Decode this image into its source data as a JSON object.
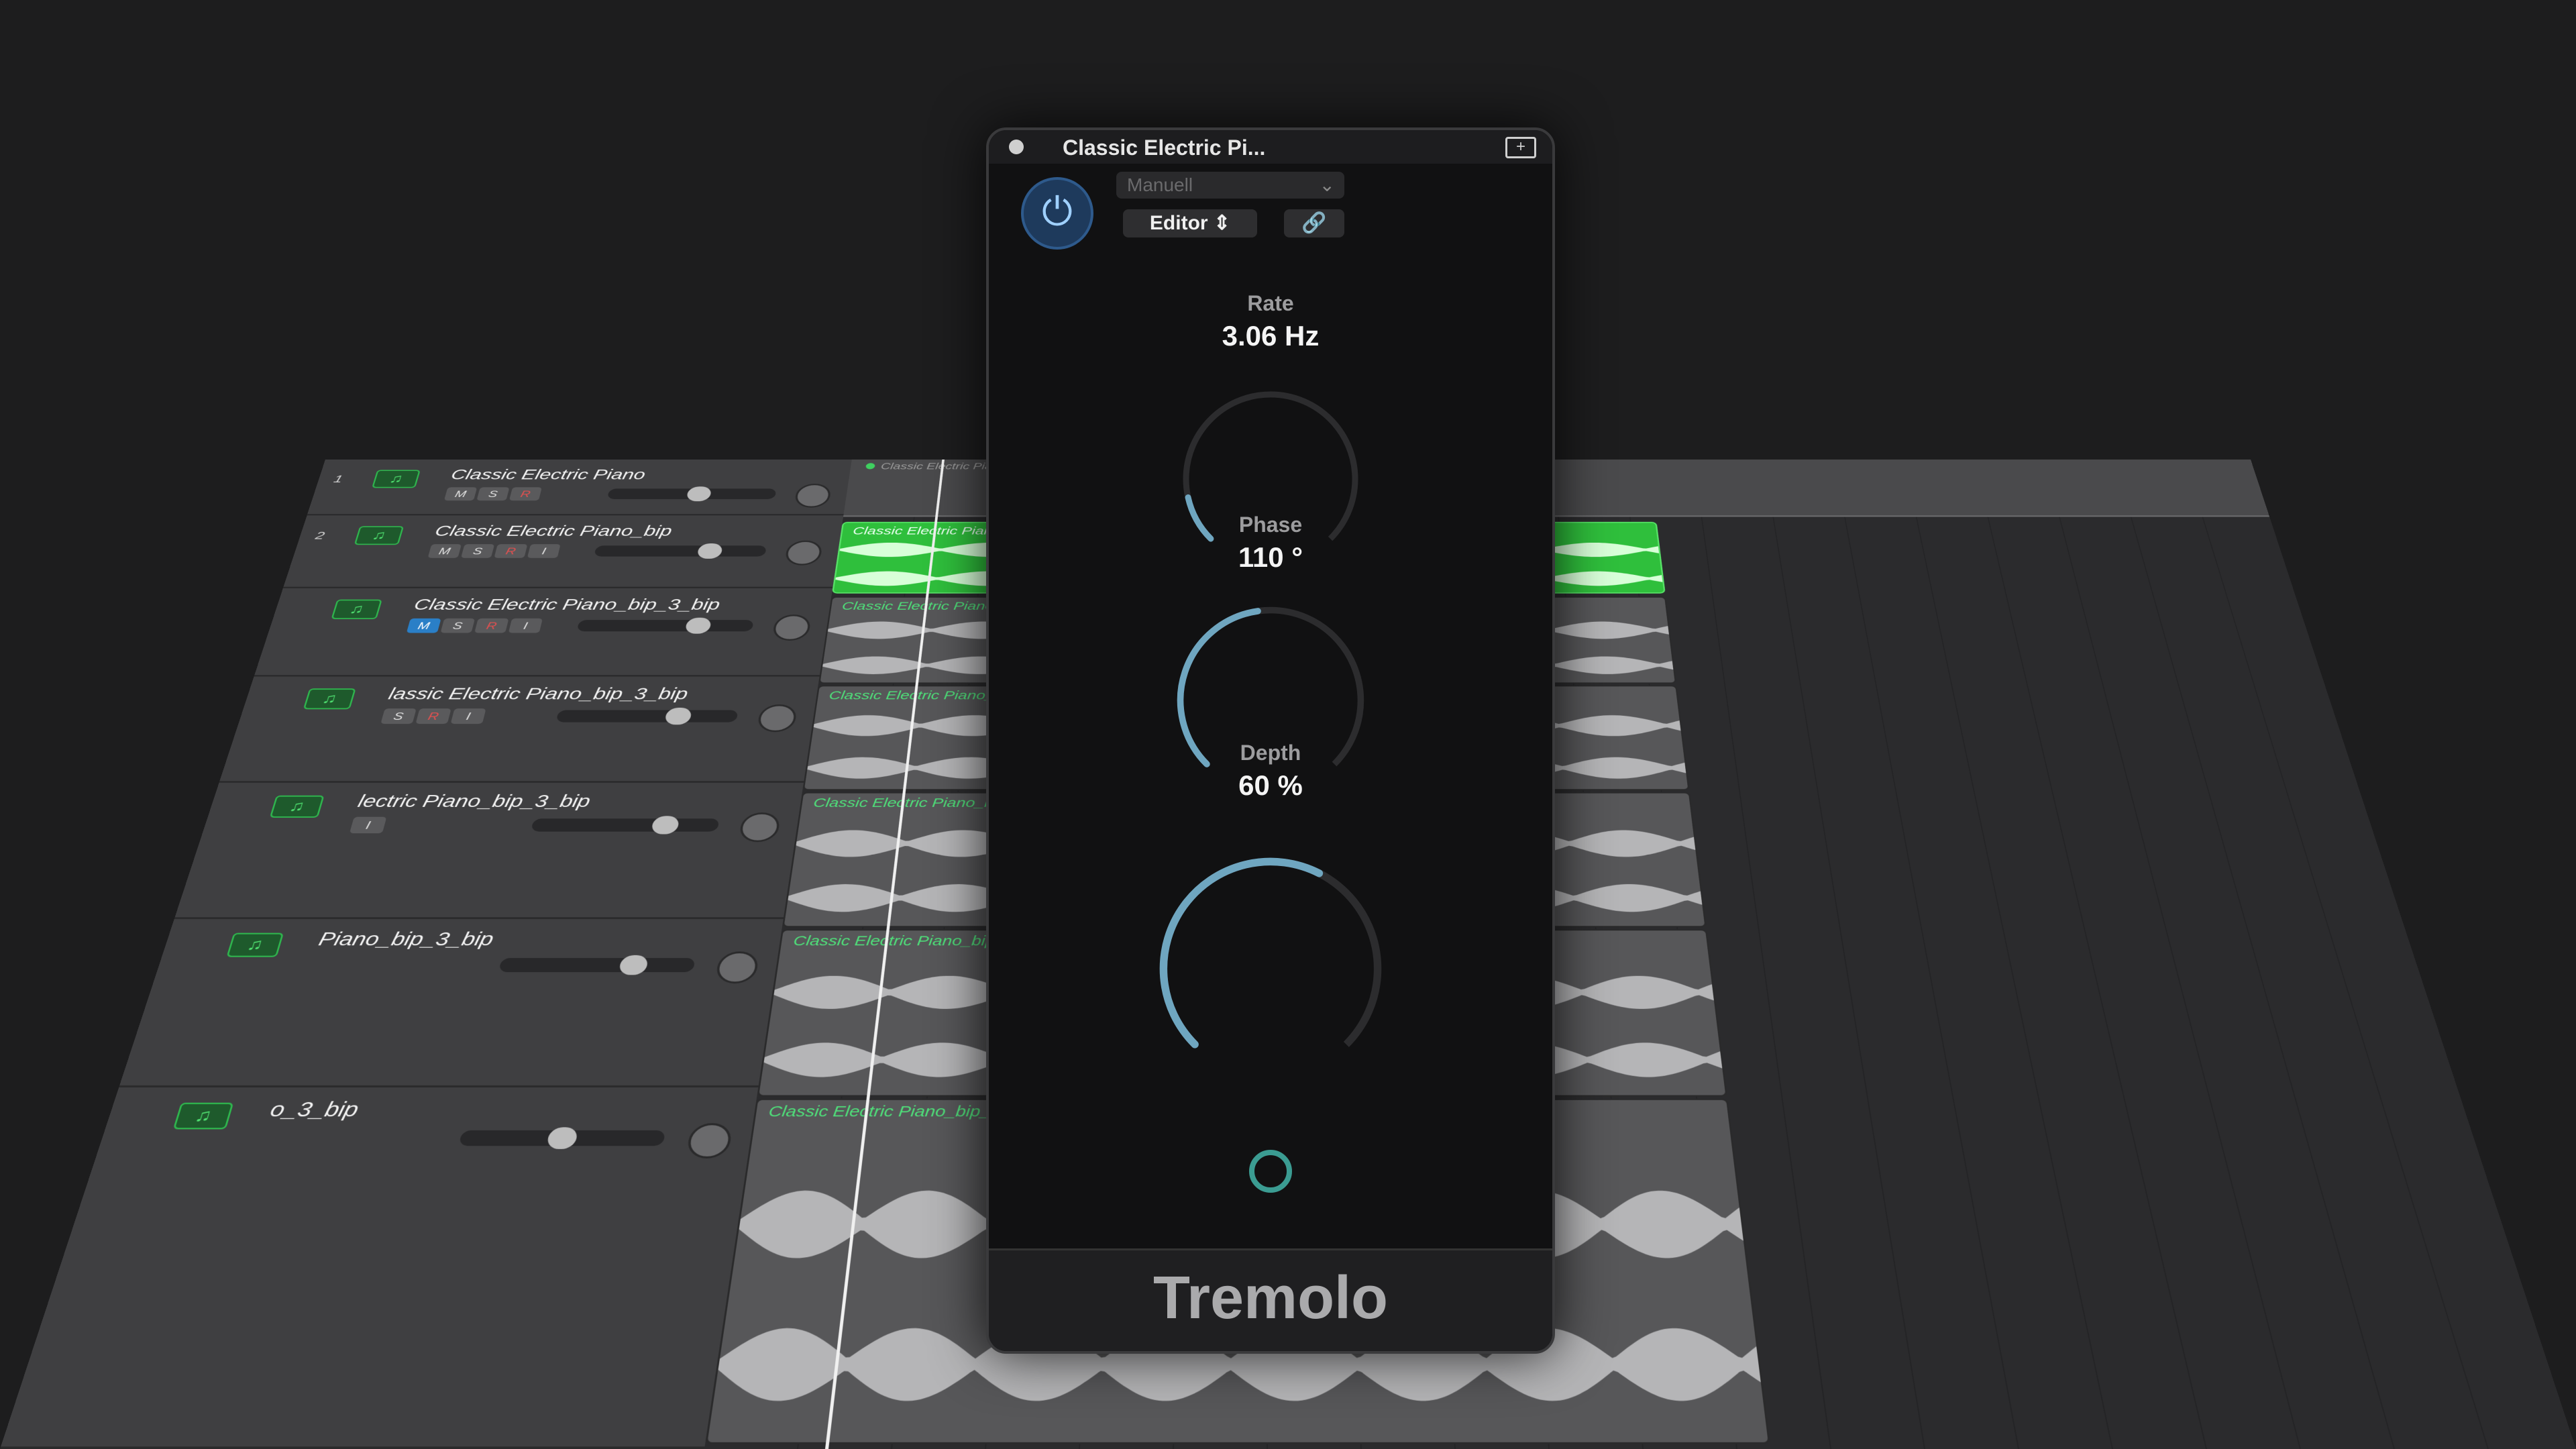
{
  "top_region": {
    "label": "Classic Electric Piano"
  },
  "tracks": [
    {
      "number": "1",
      "name": "Classic Electric Piano",
      "mute": "M",
      "solo": "S",
      "rec": "R",
      "input": "",
      "muted": false,
      "fader": 0.55
    },
    {
      "number": "2",
      "name": "Classic Electric Piano_bip",
      "mute": "M",
      "solo": "S",
      "rec": "R",
      "input": "I",
      "muted": false,
      "fader": 0.7
    },
    {
      "number": "",
      "name": "Classic Electric Piano_bip_3_bip",
      "mute": "M",
      "solo": "S",
      "rec": "R",
      "input": "I",
      "muted": true,
      "fader": 0.72
    },
    {
      "number": "",
      "name": "lassic Electric Piano_bip_3_bip",
      "mute": "",
      "solo": "S",
      "rec": "R",
      "input": "I",
      "muted": true,
      "fader": 0.7
    },
    {
      "number": "",
      "name": "lectric Piano_bip_3_bip",
      "mute": "",
      "solo": "",
      "rec": "",
      "input": "I",
      "muted": false,
      "fader": 0.75
    },
    {
      "number": "",
      "name": "Piano_bip_3_bip",
      "mute": "",
      "solo": "",
      "rec": "",
      "input": "",
      "muted": false,
      "fader": 0.72
    },
    {
      "number": "",
      "name": "o_3_bip",
      "mute": "",
      "solo": "",
      "rec": "",
      "input": "",
      "muted": false,
      "fader": 0.5
    }
  ],
  "regions": [
    {
      "name": "Classic Electric Piano_bip_3",
      "color": "green"
    },
    {
      "name": "Classic Electric Piano_bip_3_bip_30",
      "color": "gray"
    },
    {
      "name": "Classic Electric Piano_bip_3_bip_29",
      "color": "gray"
    },
    {
      "name": "Classic Electric Piano_bip_3_bip_28",
      "color": "gray"
    },
    {
      "name": "Classic Electric Piano_bip_3_bip_27",
      "color": "gray"
    },
    {
      "name": "Classic Electric Piano_bip_3_bip_26",
      "color": "gray"
    }
  ],
  "plugin": {
    "title": "Classic Electric Pi...",
    "preset": "Manuell",
    "view_label": "Editor",
    "name": "Tremolo",
    "params": [
      {
        "label": "Rate",
        "value": "3.06 Hz",
        "level": 0.12
      },
      {
        "label": "Phase",
        "value": "110 °",
        "level": 0.47
      },
      {
        "label": "Depth",
        "value": "60 %",
        "level": 0.6
      }
    ]
  },
  "colors": {
    "accent_green": "#2fbf3c",
    "knob_arc": "#6fa6c0",
    "lfo_ring": "#3b9c92"
  }
}
